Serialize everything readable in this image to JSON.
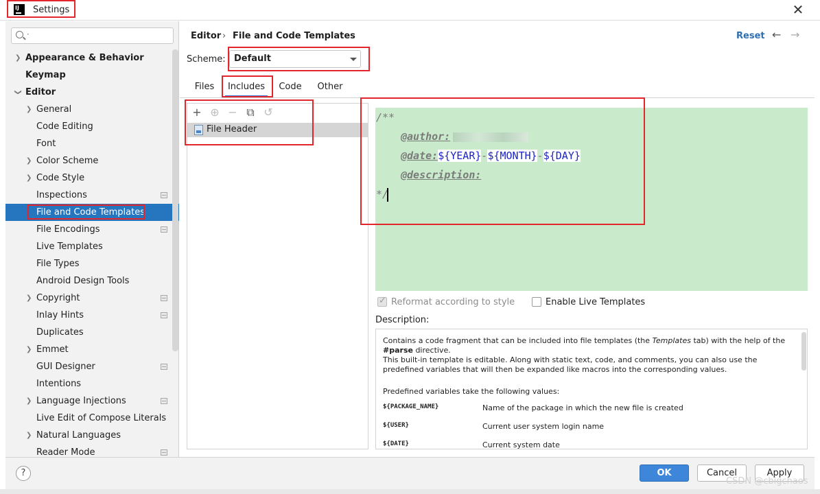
{
  "window": {
    "title": "Settings",
    "close_icon": "close-icon",
    "app_logo_text": "IJ"
  },
  "search": {
    "value": "",
    "caret": "·"
  },
  "sidebar": {
    "items": [
      {
        "label": "Appearance & Behavior",
        "bold": true,
        "chevron": "right",
        "indent": 0
      },
      {
        "label": "Keymap",
        "bold": true,
        "chevron": "none",
        "indent": 0
      },
      {
        "label": "Editor",
        "bold": true,
        "chevron": "down",
        "indent": 0
      },
      {
        "label": "General",
        "chevron": "right",
        "indent": 1
      },
      {
        "label": "Code Editing",
        "chevron": "none",
        "indent": 1
      },
      {
        "label": "Font",
        "chevron": "none",
        "indent": 1
      },
      {
        "label": "Color Scheme",
        "chevron": "right",
        "indent": 1
      },
      {
        "label": "Code Style",
        "chevron": "right",
        "indent": 1
      },
      {
        "label": "Inspections",
        "chevron": "none",
        "indent": 1,
        "project": true
      },
      {
        "label": "File and Code Templates",
        "chevron": "none",
        "indent": 1,
        "selected": true
      },
      {
        "label": "File Encodings",
        "chevron": "none",
        "indent": 1,
        "project": true
      },
      {
        "label": "Live Templates",
        "chevron": "none",
        "indent": 1
      },
      {
        "label": "File Types",
        "chevron": "none",
        "indent": 1
      },
      {
        "label": "Android Design Tools",
        "chevron": "none",
        "indent": 1
      },
      {
        "label": "Copyright",
        "chevron": "right",
        "indent": 1,
        "project": true
      },
      {
        "label": "Inlay Hints",
        "chevron": "none",
        "indent": 1,
        "project": true
      },
      {
        "label": "Duplicates",
        "chevron": "none",
        "indent": 1
      },
      {
        "label": "Emmet",
        "chevron": "right",
        "indent": 1
      },
      {
        "label": "GUI Designer",
        "chevron": "none",
        "indent": 1,
        "project": true
      },
      {
        "label": "Intentions",
        "chevron": "none",
        "indent": 1
      },
      {
        "label": "Language Injections",
        "chevron": "right",
        "indent": 1,
        "project": true
      },
      {
        "label": "Live Edit of Compose Literals",
        "chevron": "none",
        "indent": 1
      },
      {
        "label": "Natural Languages",
        "chevron": "right",
        "indent": 1
      },
      {
        "label": "Reader Mode",
        "chevron": "none",
        "indent": 1,
        "project": true
      }
    ]
  },
  "header": {
    "breadcrumb_parent": "Editor",
    "breadcrumb_sep": "›",
    "breadcrumb_current": "File and Code Templates",
    "reset_label": "Reset",
    "back_icon": "←",
    "forward_icon": "→"
  },
  "scheme": {
    "label": "Scheme:",
    "value": "Default"
  },
  "tabs": [
    "Files",
    "Includes",
    "Code",
    "Other"
  ],
  "active_tab": "Includes",
  "toolbar": {
    "add": "+",
    "copy_add": "⊕",
    "remove": "−",
    "copy": "⧉",
    "revert": "↺"
  },
  "templates": [
    "File Header"
  ],
  "editor": {
    "line1": "/**",
    "author_tag": "@author:",
    "date_tag": "@date:",
    "year_var": "${YEAR}",
    "month_var": "${MONTH}",
    "day_var": "${DAY}",
    "dash": "-",
    "desc_tag": "@description:",
    "last_line": "*/"
  },
  "options": {
    "reformat_label": "Reformat according to style",
    "reformat_checked": true,
    "live_label": "Enable Live Templates",
    "live_checked": false
  },
  "description": {
    "heading": "Description:",
    "p1a": "Contains a code fragment that can be included into file templates (the ",
    "p1_templates": "Templates",
    "p1b": " tab) with the help of the ",
    "p1_parse": "#parse",
    "p1c": " directive.",
    "p2": "This built-in template is editable. Along with static text, code, and comments, you can also use the predefined variables that will then be expanded like macros into the corresponding values.",
    "p3": "Predefined variables take the following values:",
    "variables": [
      {
        "name": "${PACKAGE_NAME}",
        "desc": "Name of the package in which the new file is created"
      },
      {
        "name": "${USER}",
        "desc": "Current user system login name"
      },
      {
        "name": "${DATE}",
        "desc": "Current system date"
      }
    ]
  },
  "buttons": {
    "help": "?",
    "ok": "OK",
    "cancel": "Cancel",
    "apply": "Apply"
  },
  "watermark": "CSDN @cbigchaos",
  "colors": {
    "accent": "#2675bf",
    "editor_bg": "#c9ebcc",
    "annotation_red": "#e3262b",
    "link": "#2f6fb2"
  }
}
